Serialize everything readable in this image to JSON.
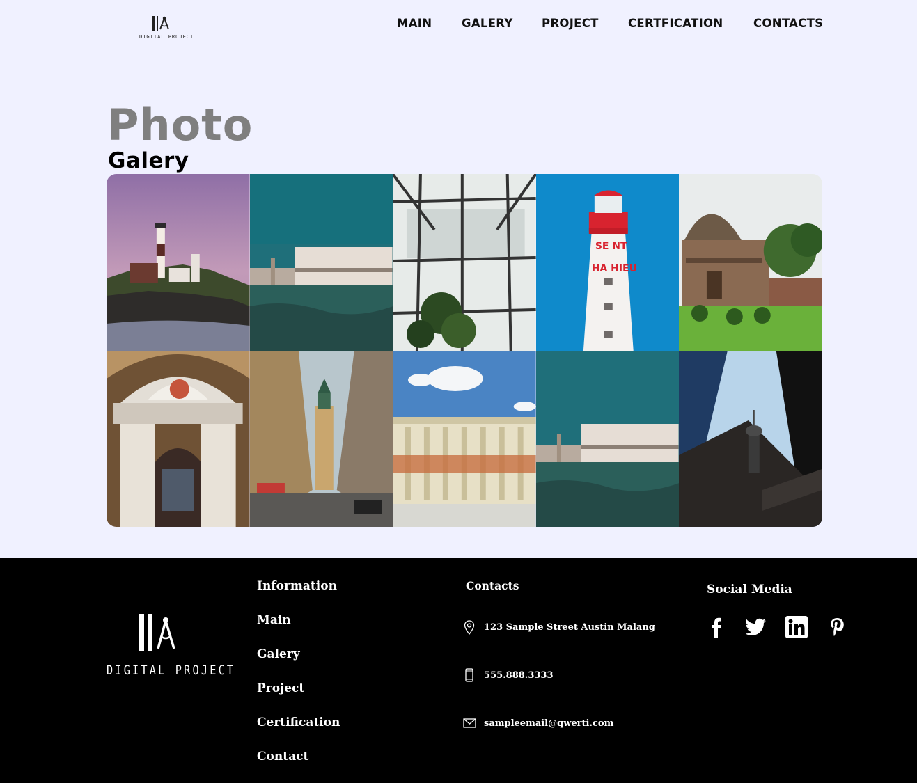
{
  "header": {
    "logo_text": "DIGITAL PROJECT",
    "nav": [
      "MAIN",
      "GALERY",
      "PROJECT",
      "CERTFICATION",
      "CONTACTS"
    ]
  },
  "title": {
    "main": "Photo",
    "sub": "Galery"
  },
  "gallery": {
    "photos": [
      "lighthouse-cliff-photo",
      "venice-palace-photo",
      "greenhouse-roof-photo",
      "red-white-lighthouse-photo",
      "domed-tomb-photo",
      "church-interior-photo",
      "city-street-photo",
      "colonnade-building-photo",
      "venice-palace-photo-2",
      "skyscrapers-tower-photo"
    ]
  },
  "footer": {
    "logo_text": "DIGITAL PROJECT",
    "information": {
      "heading": "Information",
      "links": [
        "Main",
        "Galery",
        "Project",
        "Certification",
        "Contact"
      ]
    },
    "contacts": {
      "heading": "Contacts",
      "address": "123 Sample Street Austin Malang",
      "phone": "555.888.3333",
      "email": "sampleemail@qwerti.com"
    },
    "social": {
      "heading": "Social Media",
      "icons": [
        "facebook-icon",
        "twitter-icon",
        "linkedin-icon",
        "pinterest-icon"
      ]
    }
  },
  "colors": {
    "background": "#f0f1ff",
    "footer": "#000000",
    "title_gray": "#7f7f7f"
  }
}
